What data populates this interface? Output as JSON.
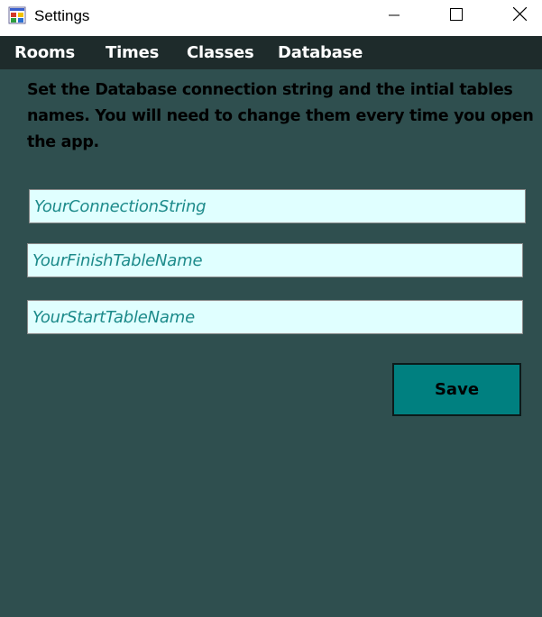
{
  "window": {
    "title": "Settings",
    "icon": "app-window-icon",
    "controls": {
      "minimize_icon": "minimize-icon",
      "maximize_icon": "maximize-icon",
      "close_icon": "close-icon"
    }
  },
  "menu": {
    "items": [
      {
        "label": "Rooms"
      },
      {
        "label": "Times"
      },
      {
        "label": "Classes"
      },
      {
        "label": "Database"
      }
    ]
  },
  "settings": {
    "instructions": "Set the Database connection string and the intial tables names. You will need to change them every time you open the app.",
    "fields": [
      {
        "value": "YourConnectionString"
      },
      {
        "value": "YourFinishTableName"
      },
      {
        "value": "YourStartTableName"
      }
    ],
    "save_label": "Save"
  },
  "colors": {
    "background": "#2f4f4f",
    "menubar": "#1e2b2b",
    "field_background": "#e0ffff",
    "field_text": "#1c8a8a",
    "button": "#008080"
  }
}
